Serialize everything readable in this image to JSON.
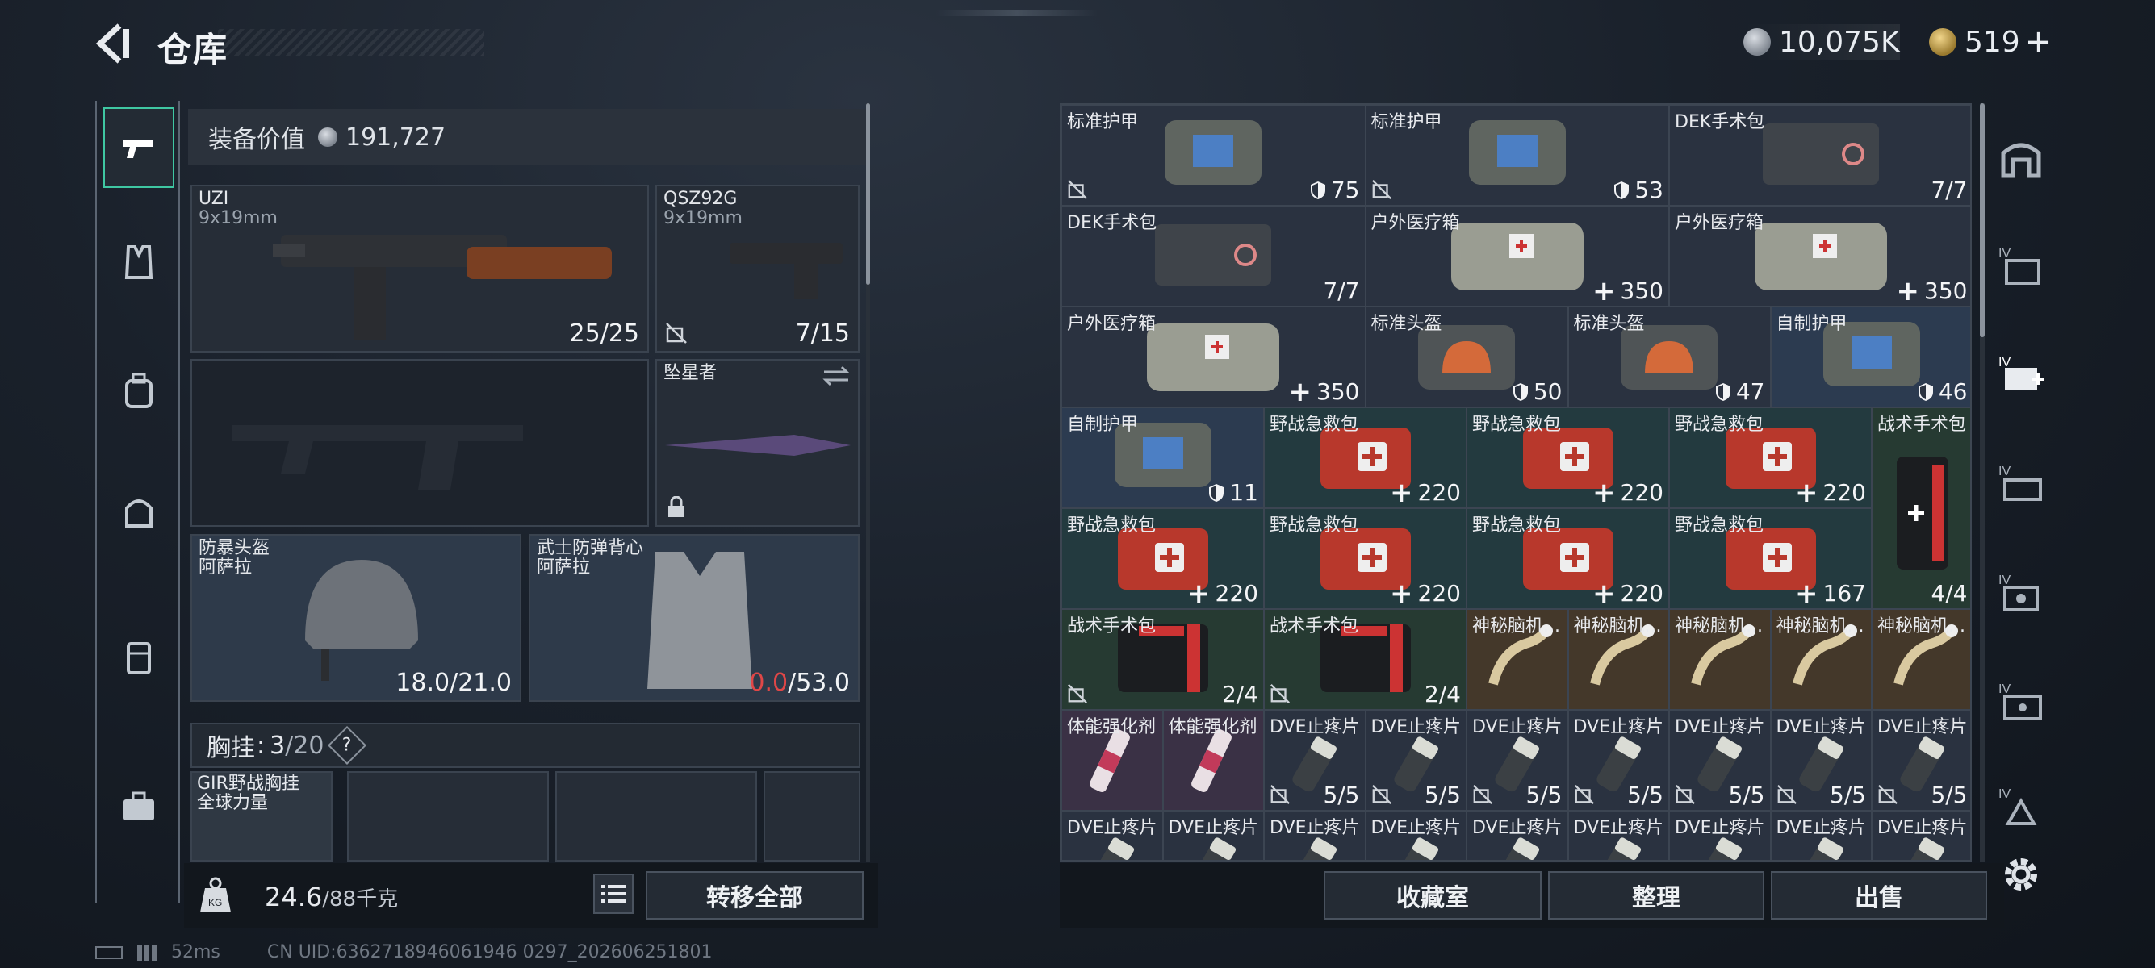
{
  "header": {
    "title": "仓库",
    "currency_silver": "10,075K",
    "currency_gold": "519",
    "gold_plus": "+"
  },
  "left_nav": {
    "items": [
      "pistol-icon",
      "vest-icon",
      "backpack-icon",
      "bag-icon",
      "case-icon",
      "toolbox-icon"
    ]
  },
  "equipment": {
    "value_label": "装备价值",
    "value": "191,727"
  },
  "weapons": [
    {
      "name": "UZI",
      "caliber": "9x19mm",
      "count": "25/25"
    },
    {
      "name": "QSZ92G",
      "caliber": "9x19mm",
      "count": "7/15"
    },
    {
      "name": "坠星者",
      "count": ""
    }
  ],
  "armor": [
    {
      "name": "防暴头盔",
      "sub": "阿萨拉",
      "durability": "18.0/21.0"
    },
    {
      "name": "武士防弹背心",
      "sub": "阿萨拉",
      "durability_cur": "0.0",
      "durability_max": "/53.0"
    }
  ],
  "chest": {
    "label": "胸挂",
    "count_cur": "3",
    "count_max": "/20",
    "help": "?",
    "rig_name": "GIR野战胸挂",
    "rig_sub": "全球力量"
  },
  "bottom_left": {
    "weight": "24.6",
    "weight_max": "/88千克",
    "kg": "KG",
    "transfer_all": "转移全部"
  },
  "inventory": [
    {
      "name": "标准护甲",
      "count": "75",
      "type": "shield",
      "lock": true
    },
    {
      "name": "标准护甲",
      "count": "53",
      "type": "shield",
      "lock": true
    },
    {
      "name": "DEK手术包",
      "count": "7/7"
    },
    {
      "name": "DEK手术包",
      "count": "7/7"
    },
    {
      "name": "户外医疗箱",
      "count": "350",
      "type": "plus"
    },
    {
      "name": "户外医疗箱",
      "count": "350",
      "type": "plus"
    },
    {
      "name": "户外医疗箱",
      "count": "350",
      "type": "plus"
    },
    {
      "name": "标准头盔",
      "count": "50",
      "type": "shield"
    },
    {
      "name": "标准头盔",
      "count": "47",
      "type": "shield"
    },
    {
      "name": "自制护甲",
      "count": "46",
      "type": "shield"
    },
    {
      "name": "自制护甲",
      "count": "11",
      "type": "shield"
    },
    {
      "name": "野战急救包",
      "count": "220",
      "type": "plus"
    },
    {
      "name": "野战急救包",
      "count": "220",
      "type": "plus"
    },
    {
      "name": "野战急救包",
      "count": "220",
      "type": "plus"
    },
    {
      "name": "战术手术包",
      "count": "4/4"
    },
    {
      "name": "野战急救包",
      "count": "220",
      "type": "plus"
    },
    {
      "name": "野战急救包",
      "count": "220",
      "type": "plus"
    },
    {
      "name": "野战急救包",
      "count": "220",
      "type": "plus"
    },
    {
      "name": "野战急救包",
      "count": "167",
      "type": "plus"
    },
    {
      "name": "战术手术包",
      "count": "2/4",
      "lock": true
    },
    {
      "name": "战术手术包",
      "count": "2/4",
      "lock": true
    },
    {
      "name": "神秘脑机...",
      "count": ""
    },
    {
      "name": "神秘脑机...",
      "count": ""
    },
    {
      "name": "神秘脑机...",
      "count": ""
    },
    {
      "name": "神秘脑机...",
      "count": ""
    },
    {
      "name": "神秘脑机...",
      "count": ""
    },
    {
      "name": "体能强化剂",
      "count": ""
    },
    {
      "name": "体能强化剂",
      "count": ""
    },
    {
      "name": "DVE止疼片",
      "count": "5/5",
      "lock": true
    },
    {
      "name": "DVE止疼片",
      "count": "5/5",
      "lock": true
    },
    {
      "name": "DVE止疼片",
      "count": "5/5",
      "lock": true
    },
    {
      "name": "DVE止疼片",
      "count": "5/5",
      "lock": true
    },
    {
      "name": "DVE止疼片",
      "count": "5/5",
      "lock": true
    },
    {
      "name": "DVE止疼片",
      "count": "5/5",
      "lock": true
    },
    {
      "name": "DVE止疼片",
      "count": "5/5",
      "lock": true
    },
    {
      "name": "DVE止疼片",
      "count": ""
    },
    {
      "name": "DVE止疼片",
      "count": ""
    },
    {
      "name": "DVE止疼片",
      "count": ""
    },
    {
      "name": "DVE止疼片",
      "count": ""
    },
    {
      "name": "DVE止疼片",
      "count": ""
    },
    {
      "name": "DVE止疼片",
      "count": ""
    },
    {
      "name": "DVE止疼片",
      "count": ""
    },
    {
      "name": "DVE止疼片",
      "count": ""
    },
    {
      "name": "DVE止疼片",
      "count": ""
    }
  ],
  "bottom_right": {
    "collection": "收藏室",
    "sort": "整理",
    "sell": "出售"
  },
  "right_nav": {
    "items": [
      "home-icon",
      "storage-1-icon",
      "storage-2-icon",
      "storage-3-icon",
      "storage-4-icon",
      "storage-5-icon",
      "storage-6-icon"
    ],
    "tier_label": "IV"
  },
  "status": {
    "ping": "52ms",
    "uid": "CN UID:6362718946061946 0297_202606251801"
  },
  "colors": {
    "accent": "#3fc7a2",
    "red": "#e04747"
  }
}
